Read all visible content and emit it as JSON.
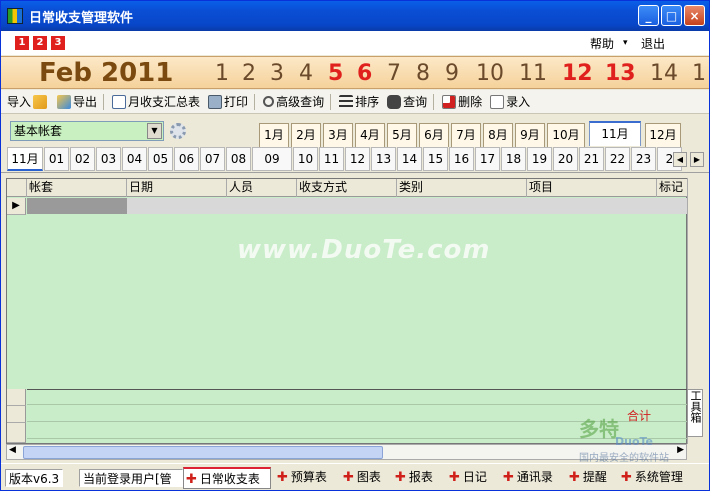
{
  "window": {
    "title": "日常收支管理软件",
    "controls": {
      "minimize": "_",
      "maximize": "□",
      "close": "×"
    }
  },
  "menubar": {
    "quick_buttons": [
      "1",
      "2",
      "3"
    ],
    "help": "帮助",
    "help_arrow": "▾",
    "exit": "退出"
  },
  "calendar": {
    "month_year": "Feb 2011",
    "days": [
      "1",
      "2",
      "3",
      "4",
      "5",
      "6",
      "7",
      "8",
      "9",
      "10",
      "11",
      "12",
      "13",
      "14",
      "1"
    ],
    "weekend_days": [
      "5",
      "6",
      "12",
      "13"
    ]
  },
  "toolbar": {
    "import": "导入",
    "export": "导出",
    "monthly_summary": "月收支汇总表",
    "print": "打印",
    "advanced_query": "高级查询",
    "sort": "排序",
    "query": "查询",
    "delete": "删除",
    "enter": "录入"
  },
  "filter": {
    "account_set": "基本帐套",
    "months": [
      "1月",
      "2月",
      "3月",
      "4月",
      "5月",
      "6月",
      "7月",
      "8月",
      "9月",
      "10月",
      "11月",
      "12月"
    ],
    "selected_month": "11月"
  },
  "day_tabs": {
    "items": [
      "11月",
      "01",
      "02",
      "03",
      "04",
      "05",
      "06",
      "07",
      "08",
      "09",
      "10",
      "11",
      "12",
      "13",
      "14",
      "15",
      "16",
      "17",
      "18",
      "19",
      "20",
      "21",
      "22",
      "23",
      "2"
    ],
    "selected": "11月"
  },
  "grid": {
    "columns": [
      "帐套",
      "日期",
      "人员",
      "收支方式",
      "类别",
      "项目",
      "标记"
    ],
    "summary_label": "合计",
    "current_row_marker": "▶"
  },
  "side_tab": {
    "label": "工具箱"
  },
  "statusbar": {
    "version": "版本v6.3",
    "current_user": "当前登录用户[管",
    "tabs": [
      "日常收支表",
      "预算表",
      "图表",
      "报表",
      "日记",
      "通讯录",
      "提醒",
      "系统管理"
    ],
    "selected_tab": "日常收支表"
  },
  "watermark": {
    "text": "www.DuoTe.com",
    "logo_text": "多特",
    "logo_sub": "DuoTe",
    "logo_caption": "国内最安全的软件站"
  },
  "colors": {
    "title_bar": "#0a4fd6",
    "grid_bg": "#c9ecc9",
    "weekend": "#e0201c",
    "date_band": "#f5d29a"
  }
}
